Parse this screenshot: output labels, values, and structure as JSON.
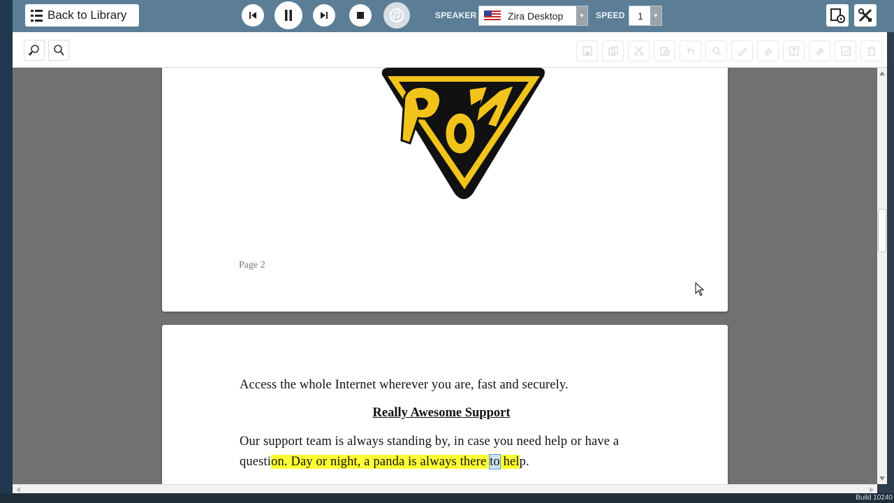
{
  "header": {
    "back_label": "Back to Library",
    "speaker_label": "SPEAKER",
    "speaker_value": "Zira Desktop",
    "speed_label": "SPEED",
    "speed_value": "1"
  },
  "icons": {
    "back": "list-icon",
    "prev": "skip-previous-icon",
    "pause": "pause-icon",
    "next": "skip-next-icon",
    "stop": "stop-icon",
    "repeat": "repeat-music-icon",
    "flag": "us-flag-icon",
    "reader_settings": "screen-settings-icon",
    "tools": "tools-icon",
    "zoom_in": "zoom-in-icon",
    "zoom_out": "zoom-out-icon"
  },
  "document": {
    "page2_label": "Page 2",
    "line1": "Access the whole Internet wherever you are, fast and securely.",
    "heading": "Really Awesome Support",
    "para_line1": "Our support team is always standing by, in case you need help or have a",
    "para_line2_pre": "questi",
    "para_line2_hl1": "on. Day or night, a panda is always there ",
    "para_line2_word": "to",
    "para_line2_hl2": " hel",
    "para_line2_post": "p."
  },
  "footer": {
    "build_text": "Build 10240"
  },
  "colors": {
    "topbar": "#5b7e96",
    "highlight": "#ffff33",
    "logo_gold": "#f2c31b"
  }
}
